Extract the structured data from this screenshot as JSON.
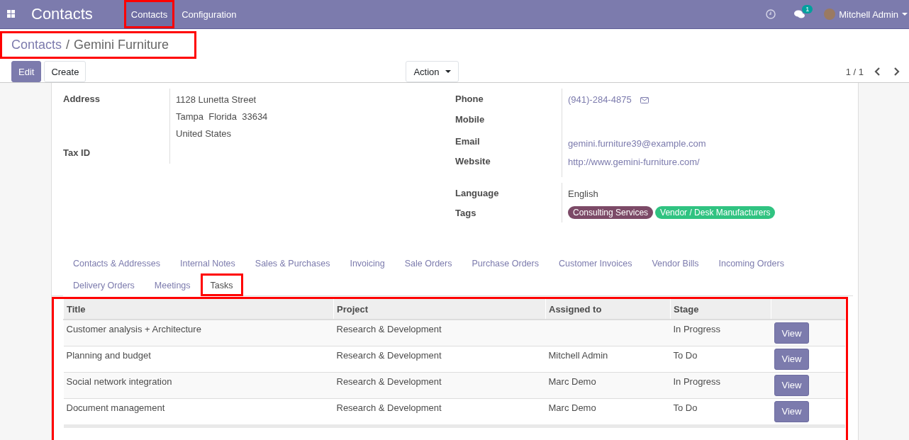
{
  "navbar": {
    "app_title": "Contacts",
    "menu": [
      {
        "label": "Contacts",
        "highlighted": true
      },
      {
        "label": "Configuration",
        "highlighted": false
      }
    ],
    "messages_badge": "1",
    "user": "Mitchell Admin"
  },
  "breadcrumb": {
    "parent": "Contacts",
    "separator": "/",
    "current": "Gemini Furniture",
    "highlighted": true
  },
  "buttons": [
    {
      "label": "Edit",
      "kind": "primary"
    },
    {
      "label": "Create",
      "kind": "secondary"
    }
  ],
  "action": {
    "label": "Action"
  },
  "pager": "1 / 1",
  "left_fields": [
    {
      "label": "Address",
      "lines": [
        "1128 Lunetta Street",
        "Tampa  Florida  33634",
        "United States"
      ]
    },
    {
      "label": "Tax ID"
    }
  ],
  "right_fields": [
    {
      "label": "Phone",
      "kind": "phone",
      "value": "(941)-284-4875"
    },
    {
      "label": "Mobile",
      "kind": "text"
    },
    {
      "label": "Email",
      "kind": "link",
      "value": "gemini.furniture39@example.com"
    },
    {
      "label": "Website",
      "kind": "link",
      "value": "http://www.gemini-furniture.com/"
    },
    {
      "label": "Language",
      "kind": "text",
      "value": "English"
    },
    {
      "label": "Tags",
      "kind": "tags",
      "tags": [
        {
          "label": "Consulting Services",
          "color": "#7c4a67"
        },
        {
          "label": "Vendor / Desk Manufacturers",
          "color": "#30c381"
        }
      ]
    }
  ],
  "tabs": [
    {
      "label": "Contacts & Addresses",
      "selected": false,
      "highlighted": false
    },
    {
      "label": "Internal Notes",
      "selected": false,
      "highlighted": false
    },
    {
      "label": "Sales & Purchases",
      "selected": false,
      "highlighted": false
    },
    {
      "label": "Invoicing",
      "selected": false,
      "highlighted": false
    },
    {
      "label": "Sale Orders",
      "selected": false,
      "highlighted": false
    },
    {
      "label": "Purchase Orders",
      "selected": false,
      "highlighted": false
    },
    {
      "label": "Customer Invoices",
      "selected": false,
      "highlighted": false
    },
    {
      "label": "Vendor Bills",
      "selected": false,
      "highlighted": false
    },
    {
      "label": "Incoming Orders",
      "selected": false,
      "highlighted": false
    },
    {
      "label": "Delivery Orders",
      "selected": false,
      "highlighted": false
    },
    {
      "label": "Meetings",
      "selected": false,
      "highlighted": false
    },
    {
      "label": "Tasks",
      "selected": true,
      "highlighted": true
    }
  ],
  "table": {
    "highlighted": true,
    "columns": [
      "Title",
      "Project",
      "Assigned to",
      "Stage"
    ],
    "rows": [
      {
        "title": "Customer analysis + Architecture",
        "project": "Research & Development",
        "stage": "In Progress",
        "action": "View"
      },
      {
        "title": "Planning and budget",
        "project": "Research & Development",
        "assigned_to": "Mitchell Admin",
        "stage": "To Do",
        "action": "View"
      },
      {
        "title": "Social network integration",
        "project": "Research & Development",
        "assigned_to": "Marc Demo",
        "stage": "In Progress",
        "action": "View"
      },
      {
        "title": "Document management",
        "project": "Research & Development",
        "assigned_to": "Marc Demo",
        "stage": "To Do",
        "action": "View"
      }
    ]
  }
}
